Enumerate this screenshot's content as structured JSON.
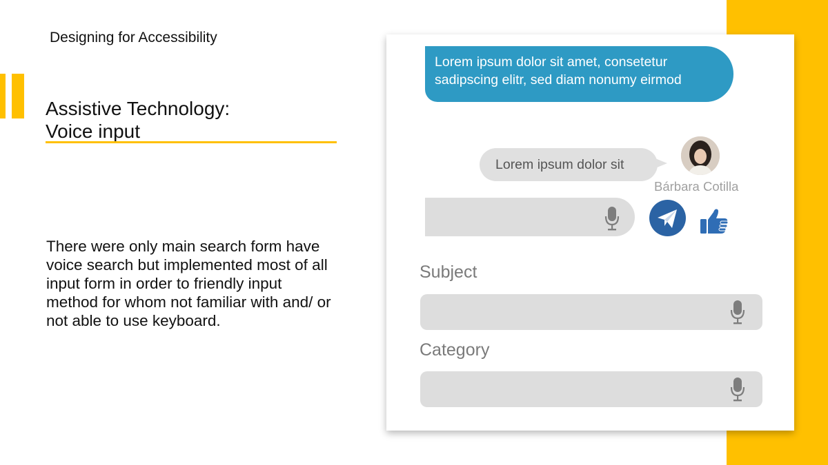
{
  "deck_title": "Designing for Accessibility",
  "heading": {
    "line1": "Assistive Technology:",
    "line2": "Voice input"
  },
  "body": "There were only main search form have voice search but implemented most of all input form in order to friendly input method for whom not familiar with and/ or not able to use keyboard.",
  "chat": {
    "outgoing_message": "Lorem ipsum dolor sit amet, consetetur sadipscing elitr, sed diam nonumy eirmod",
    "incoming_message": "Lorem ipsum dolor sit",
    "sender_name": "Bárbara Cotilla",
    "message_input_value": ""
  },
  "form": {
    "subject_label": "Subject",
    "subject_value": "",
    "category_label": "Category",
    "category_value": ""
  },
  "icons": {
    "mic": "microphone-icon",
    "send": "paper-plane-icon",
    "like": "thumbs-up-icon"
  },
  "colors": {
    "accent_yellow": "#FFC000",
    "bubble_blue": "#2E9AC4",
    "send_blue": "#2B63A4",
    "like_blue": "#2F6DB5"
  }
}
